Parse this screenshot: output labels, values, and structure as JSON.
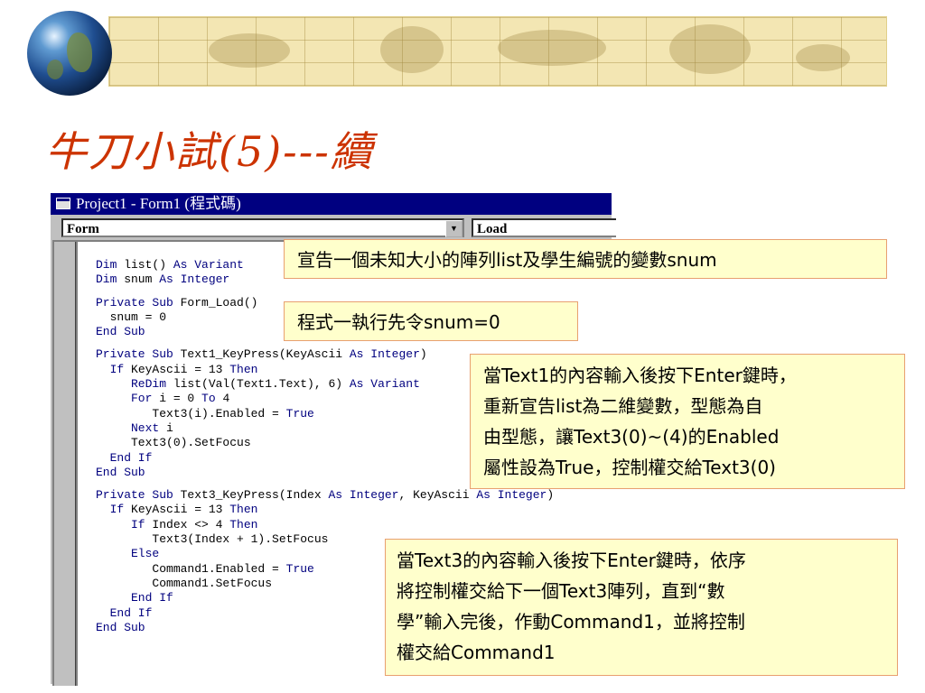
{
  "slide": {
    "title": "牛刀小試(5)---續"
  },
  "window": {
    "title": "Project1 - Form1 (程式碼)",
    "object_combo": "Form",
    "procedure_combo": "Load"
  },
  "code_lines": [
    [
      {
        "t": "Dim",
        "k": true
      },
      {
        "t": " list() "
      },
      {
        "t": "As Variant",
        "k": true
      }
    ],
    [
      {
        "t": "Dim",
        "k": true
      },
      {
        "t": " snum "
      },
      {
        "t": "As Integer",
        "k": true
      }
    ],
    null,
    [
      {
        "t": "Private Sub",
        "k": true
      },
      {
        "t": " Form_Load()"
      }
    ],
    [
      {
        "t": "  snum = 0"
      }
    ],
    [
      {
        "t": "End Sub",
        "k": true
      }
    ],
    null,
    [
      {
        "t": "Private Sub",
        "k": true
      },
      {
        "t": " Text1_KeyPress(KeyAscii "
      },
      {
        "t": "As Integer",
        "k": true
      },
      {
        "t": ")"
      }
    ],
    [
      {
        "t": "  If",
        "k": true
      },
      {
        "t": " KeyAscii = 13 "
      },
      {
        "t": "Then",
        "k": true
      }
    ],
    [
      {
        "t": "     ReDim",
        "k": true
      },
      {
        "t": " list(Val(Text1.Text), 6) "
      },
      {
        "t": "As Variant",
        "k": true
      }
    ],
    [
      {
        "t": "     For",
        "k": true
      },
      {
        "t": " i = 0 "
      },
      {
        "t": "To",
        "k": true
      },
      {
        "t": " 4"
      }
    ],
    [
      {
        "t": "        Text3(i).Enabled = "
      },
      {
        "t": "True",
        "k": true
      }
    ],
    [
      {
        "t": "     Next",
        "k": true
      },
      {
        "t": " i"
      }
    ],
    [
      {
        "t": "     Text3(0).SetFocus"
      }
    ],
    [
      {
        "t": "  End If",
        "k": true
      }
    ],
    [
      {
        "t": "End Sub",
        "k": true
      }
    ],
    null,
    [
      {
        "t": "Private Sub",
        "k": true
      },
      {
        "t": " Text3_KeyPress(Index "
      },
      {
        "t": "As Integer",
        "k": true
      },
      {
        "t": ", KeyAscii "
      },
      {
        "t": "As Integer",
        "k": true
      },
      {
        "t": ")"
      }
    ],
    [
      {
        "t": "  If",
        "k": true
      },
      {
        "t": " KeyAscii = 13 "
      },
      {
        "t": "Then",
        "k": true
      }
    ],
    [
      {
        "t": "     If",
        "k": true
      },
      {
        "t": " Index <> 4 "
      },
      {
        "t": "Then",
        "k": true
      }
    ],
    [
      {
        "t": "        Text3(Index + 1).SetFocus"
      }
    ],
    [
      {
        "t": "     Else",
        "k": true
      }
    ],
    [
      {
        "t": "        Command1.Enabled = "
      },
      {
        "t": "True",
        "k": true
      }
    ],
    [
      {
        "t": "        Command1.SetFocus"
      }
    ],
    [
      {
        "t": "     End If",
        "k": true
      }
    ],
    [
      {
        "t": "  End If",
        "k": true
      }
    ],
    [
      {
        "t": "End Sub",
        "k": true
      }
    ]
  ],
  "callouts": {
    "c1": [
      "宣告一個未知大小的陣列list及學生編號的變數snum"
    ],
    "c2": [
      "程式一執行先令snum=0"
    ],
    "c3": [
      "當Text1的內容輸入後按下Enter鍵時，",
      "重新宣告list為二維變數，型態為自",
      "由型態，讓Text3(0)~(4)的Enabled",
      "屬性設為True，控制權交給Text3(0)"
    ],
    "c4": [
      "當Text3的內容輸入後按下Enter鍵時，依序",
      "將控制權交給下一個Text3陣列，直到“數",
      "學”輸入完後，作動Command1，並將控制",
      "權交給Command1"
    ]
  },
  "colors": {
    "title": "#cc3300",
    "keyword": "#00007f",
    "callout_bg": "#ffffcc",
    "titlebar": "#000080"
  }
}
